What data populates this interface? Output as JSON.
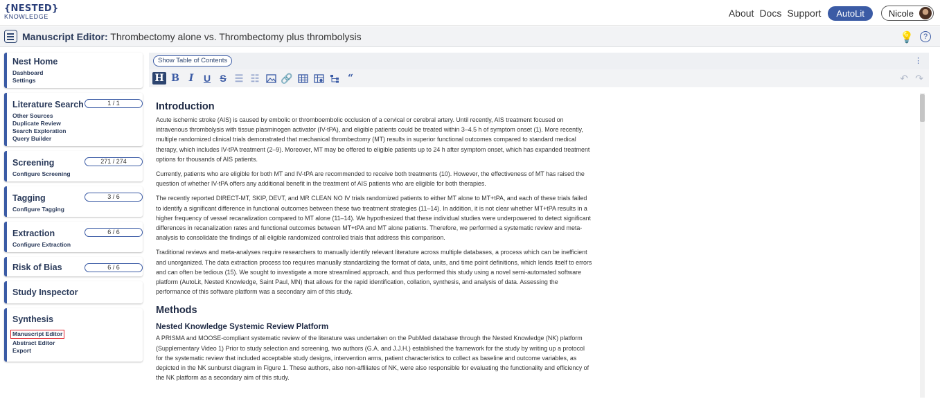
{
  "nav": {
    "logo_top": "{NESTED}",
    "logo_bottom": "KNOWLEDGE",
    "links": [
      "About",
      "Docs",
      "Support"
    ],
    "autolit": "AutoLit",
    "user": "Nicole"
  },
  "titlebar": {
    "label": "Manuscript Editor:",
    "title": " Thrombectomy alone vs. Thrombectomy plus thrombolysis"
  },
  "sidebar": {
    "nest_home": {
      "title": "Nest Home",
      "items": [
        "Dashboard",
        "Settings"
      ]
    },
    "literature_search": {
      "title": "Literature Search",
      "count": "1 / 1",
      "items": [
        "Other Sources",
        "Duplicate Review",
        "Search Exploration",
        "Query Builder"
      ]
    },
    "screening": {
      "title": "Screening",
      "count": "271 / 274",
      "items": [
        "Configure Screening"
      ]
    },
    "tagging": {
      "title": "Tagging",
      "count": "3 / 6",
      "items": [
        "Configure Tagging"
      ]
    },
    "extraction": {
      "title": "Extraction",
      "count": "6 / 6",
      "items": [
        "Configure Extraction"
      ]
    },
    "risk_of_bias": {
      "title": "Risk of Bias",
      "count": "6 / 6"
    },
    "study_inspector": {
      "title": "Study Inspector"
    },
    "synthesis": {
      "title": "Synthesis",
      "items": [
        "Manuscript Editor",
        "Abstract Editor",
        "Export"
      ]
    }
  },
  "editor": {
    "toc_button": "Show Table of Contents",
    "toolbar": [
      "H",
      "B",
      "I",
      "U",
      "S",
      "bullet-list-icon",
      "numbered-list-icon",
      "image-icon",
      "link-icon",
      "table-icon",
      "table-edit-icon",
      "tree-icon",
      "quote-icon"
    ],
    "intro_heading": "Introduction",
    "p1": "Acute ischemic stroke (AIS) is caused by embolic or thromboembolic occlusion of a cervical or cerebral artery. Until recently, AIS treatment focused on intravenous thrombolysis with tissue plasminogen activator (IV-tPA), and eligible patients could be treated within 3–4.5 h of symptom onset (1). More recently, multiple randomized clinical trials demonstrated that mechanical thrombectomy (MT) results in superior functional outcomes compared to standard medical therapy, which includes IV-tPA treatment (2–9). Moreover, MT may be offered to eligible patients up to 24 h after symptom onset, which has expanded treatment options for thousands of AIS patients.",
    "p2": "Currently, patients who are eligible for both MT and IV-tPA are recommended to receive both treatments (10). However, the effectiveness of MT has raised the question of whether IV-tPA offers any additional benefit in the treatment of AIS patients who are eligible for both therapies.",
    "p3": "The recently reported DIRECT-MT, SKIP, DEVT, and MR CLEAN NO IV trials randomized patients to either MT alone to MT+tPA, and each of these trials failed to identify a significant difference in functional outcomes between these two treatment strategies (11–14). In addition, it is not clear whether MT+tPA results in a higher frequency of vessel recanalization compared to MT alone (11–14). We hypothesized that these individual studies were underpowered to detect significant differences in recanalization rates and functional outcomes between MT+tPA and MT alone patients. Therefore, we performed a systematic review and meta-analysis to consolidate the findings of all eligible randomized controlled trials that address this comparison.",
    "p4": "Traditional reviews and meta-analyses require researchers to manually identify relevant literature across multiple databases, a process which can be inefficient and unorganized. The data extraction process too requires manually standardizing the format of data, units, and time point definitions, which lends itself to errors and can often be tedious (15). We sought to investigate a more streamlined approach, and thus performed this study using a novel semi-automated software platform (AutoLit, Nested Knowledge, Saint Paul, MN) that allows for the rapid identification, collation, synthesis, and analysis of data. Assessing the performance of this software platform was a secondary aim of this study.",
    "methods_heading": "Methods",
    "sub_heading": "Nested Knowledge Systemic Review Platform",
    "p5": "A PRISMA and MOOSE-compliant systematic review of the literature was undertaken on the PubMed database through the Nested Knowledge (NK) platform (Supplementary Video 1) Prior to study selection and screening, two authors (G.A. and J.J.H.) established the framework for the study by writing up a protocol for the systematic review that included acceptable study designs, intervention arms, patient characteristics to collect as baseline and outcome variables, as depicted in the NK sunburst diagram in Figure 1. These authors, also non-affiliates of NK, were also responsible for evaluating the functionality and efficiency of the NK platform as a secondary aim of this study."
  }
}
